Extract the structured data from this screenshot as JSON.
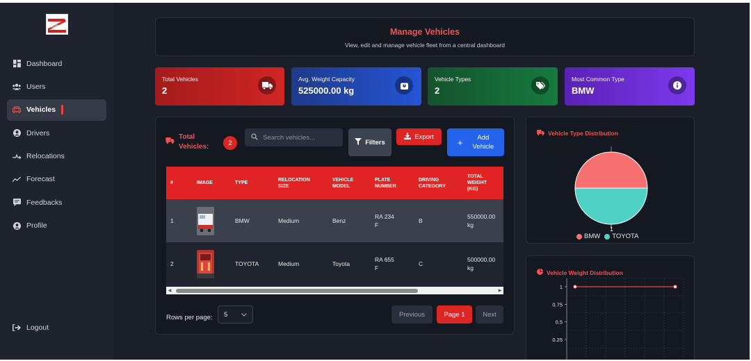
{
  "sidebar": {
    "items": [
      {
        "label": "Dashboard",
        "icon": "dashboard-icon"
      },
      {
        "label": "Users",
        "icon": "users-icon"
      },
      {
        "label": "Vehicles",
        "icon": "car-icon",
        "active": true
      },
      {
        "label": "Drivers",
        "icon": "user-circle-icon"
      },
      {
        "label": "Relocations",
        "icon": "relocation-icon"
      },
      {
        "label": "Forecast",
        "icon": "chart-line-icon"
      },
      {
        "label": "Feedbacks",
        "icon": "comment-icon"
      },
      {
        "label": "Profile",
        "icon": "user-circle-icon"
      }
    ],
    "logout_label": "Logout",
    "logo_text": "AGS"
  },
  "header": {
    "title": "Manage Vehicles",
    "subtitle": "View, edit and manage vehicle fleet from a central dashboard"
  },
  "stats": [
    {
      "label": "Total Vehicles",
      "value": "2",
      "icon": "truck-icon"
    },
    {
      "label": "Avg. Weight Capacity",
      "value": "525000.00 kg",
      "icon": "weight-icon"
    },
    {
      "label": "Vehicle Types",
      "value": "2",
      "icon": "tags-icon"
    },
    {
      "label": "Most Common Type",
      "value": "BMW",
      "icon": "info-icon"
    }
  ],
  "table_panel": {
    "title_line1": "Total",
    "title_line2": "Vehicles:",
    "count": "2",
    "search_placeholder": "Search vehicles...",
    "filters_label": "Filters",
    "export_label": "Export",
    "add_label_line1": "Add",
    "add_label_line2": "Vehicle",
    "columns": [
      [
        "#"
      ],
      [
        "IMAGE"
      ],
      [
        "TYPE"
      ],
      [
        "RELOCATION",
        "SIZE"
      ],
      [
        "VEHICLE",
        "MODEL"
      ],
      [
        "PLATE",
        "NUMBER"
      ],
      [
        "DRIVING",
        "CATEGORY"
      ],
      [
        "TOTAL",
        "WEIGHT",
        "(KG)"
      ]
    ],
    "rows": [
      {
        "num": "1",
        "type": "BMW",
        "size": "Medium",
        "model": "Benz",
        "plate1": "RA 234",
        "plate2": "F",
        "category": "B",
        "weight1": "550000.00",
        "weight2": "kg"
      },
      {
        "num": "2",
        "type": "TOYOTA",
        "size": "Medium",
        "model": "Toyota",
        "plate1": "RA 655",
        "plate2": "F",
        "category": "C",
        "weight1": "500000.00",
        "weight2": "kg"
      }
    ],
    "rows_per_page_label": "Rows per page:",
    "rows_per_page_value": "5",
    "prev_label": "Previous",
    "page_label": "Page 1",
    "next_label": "Next"
  },
  "charts": {
    "type_title": "Vehicle Type Distribution",
    "weight_title": "Vehicle Weight Distribution"
  },
  "chart_data": [
    {
      "type": "pie",
      "title": "Vehicle Type Distribution",
      "categories": [
        "BMW",
        "TOYOTA"
      ],
      "values": [
        1,
        1
      ],
      "colors": [
        "#f87171",
        "#4fd1c5"
      ],
      "data_labels": [
        "1",
        "1"
      ],
      "legend": "bottom"
    },
    {
      "type": "line",
      "title": "Vehicle Weight Distribution",
      "series": [
        {
          "values": [
            1,
            1
          ],
          "color": "#ef4444"
        }
      ],
      "y_ticks": [
        "1",
        "0.75",
        "0.5",
        "0.25"
      ],
      "grid": true
    }
  ],
  "colors": {
    "accent_red": "#dc2626",
    "accent_blue": "#2563eb",
    "pie_bmw": "#f87171",
    "pie_toyota": "#4fd1c5"
  }
}
